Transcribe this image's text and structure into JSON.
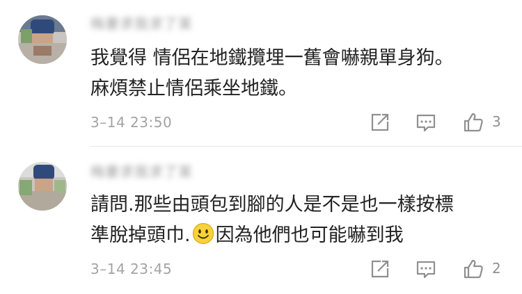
{
  "comments": [
    {
      "username": "梅妻求我求了某",
      "lines": [
        "我覺得 情侶在地鐵攬埋一舊會嚇親單身狗。",
        "麻煩禁止情侶乘坐地鐵。"
      ],
      "timestamp": "3–14 23:50",
      "likes": "3",
      "actions": [
        "share-icon",
        "reply-icon",
        "like-icon"
      ]
    },
    {
      "username": "梅妻求我求了某",
      "lines": [
        "請問.那些由頭包到腳的人是不是也一樣按標",
        "準脫掉頭巾.",
        "因為他們也可能嚇到我"
      ],
      "timestamp": "3–14 23:45",
      "likes": "2",
      "actions": [
        "share-icon",
        "reply-icon",
        "like-icon"
      ]
    }
  ],
  "colors": {
    "text": "#222222",
    "meta": "#a3a3a3",
    "icon": "#8f8f8f",
    "divider": "#e6e6e6"
  }
}
